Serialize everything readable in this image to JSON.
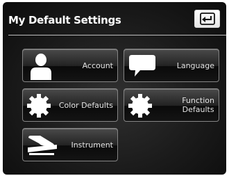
{
  "header": {
    "title": "My Default Settings"
  },
  "tiles": [
    {
      "label": "Account",
      "icon": "user-icon"
    },
    {
      "label": "Language",
      "icon": "speech-bubble-icon"
    },
    {
      "label": "Color Defaults",
      "icon": "gear-icon"
    },
    {
      "label": "Function\nDefaults",
      "icon": "gear-icon"
    },
    {
      "label": "Instrument",
      "icon": "instrument-icon"
    }
  ]
}
